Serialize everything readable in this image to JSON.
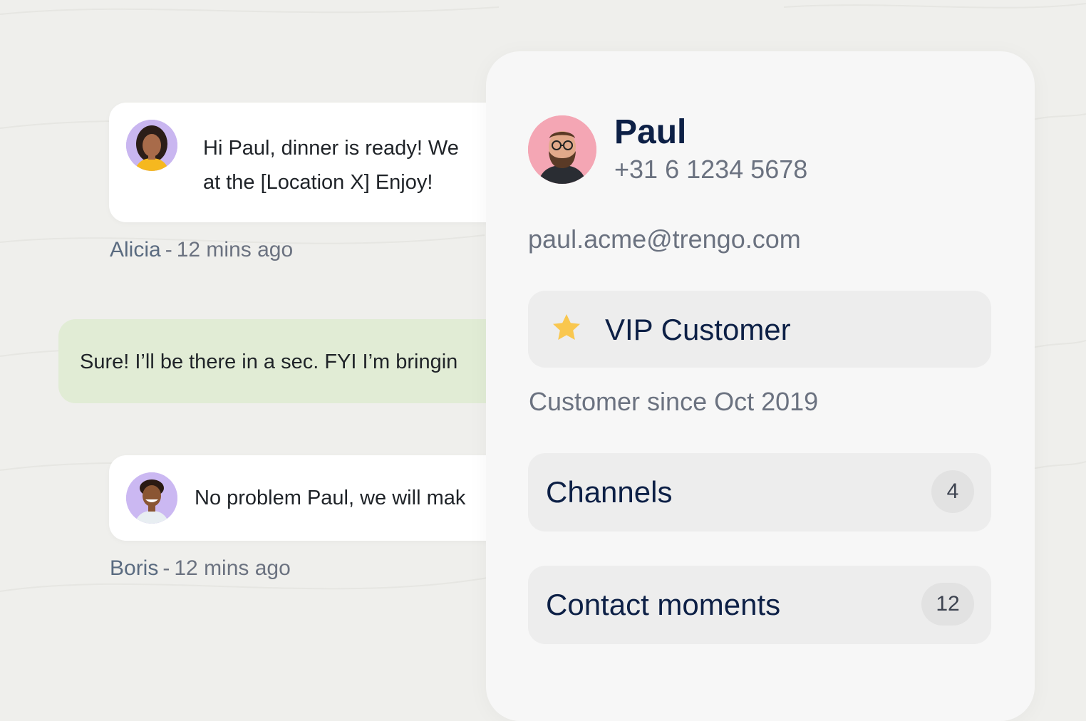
{
  "chat": {
    "messages": [
      {
        "sender": "Alicia",
        "time": "12 mins ago",
        "lines": [
          "Hi Paul, dinner is ready! We",
          "at the [Location X] Enjoy!"
        ]
      },
      {
        "text": "Sure! I’ll be there in a sec. FYI I’m bringin"
      },
      {
        "sender": "Boris",
        "time": "12 mins ago",
        "text": "No problem Paul, we will mak"
      }
    ],
    "separator": "-"
  },
  "contact": {
    "name": "Paul",
    "phone": "+31 6 1234 5678",
    "email": "paul.acme@trengo.com",
    "vip_label": "VIP Customer",
    "vip_icon": "star-icon",
    "since": "Customer since Oct 2019",
    "rows": [
      {
        "label": "Channels",
        "count": "4"
      },
      {
        "label": "Contact moments",
        "count": "12"
      }
    ]
  },
  "colors": {
    "background": "#efefec",
    "panel": "#f7f7f7",
    "accent_text": "#0d2046",
    "muted_text": "#6b7280",
    "green_bubble": "#e1ecd5",
    "star": "#f9c74f"
  }
}
